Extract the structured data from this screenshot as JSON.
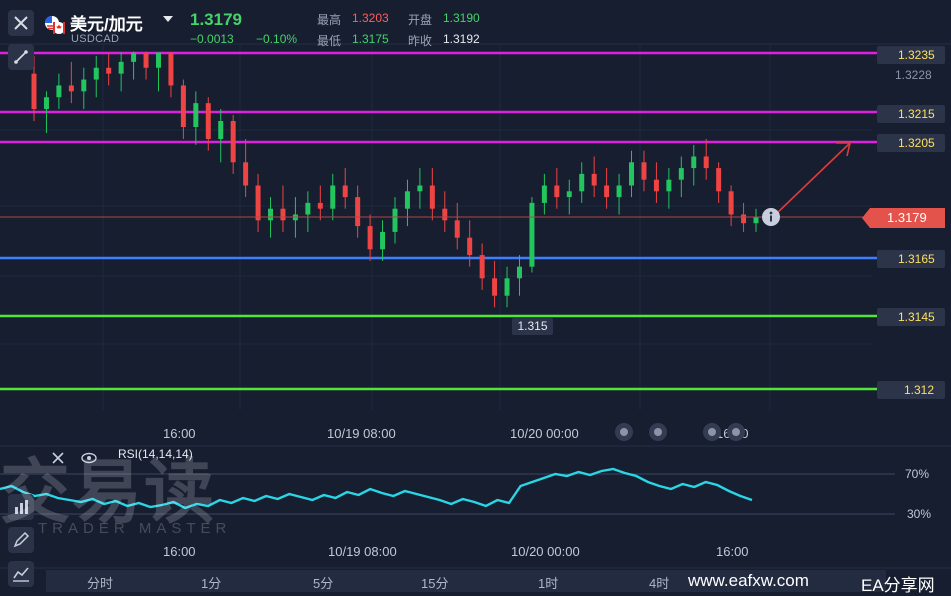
{
  "header": {
    "title": "美元/加元",
    "code": "USDCAD",
    "last": "1.3179",
    "change": "−0.0013",
    "change_pct": "−0.10%",
    "quotes": [
      {
        "label": "最高",
        "value": "1.3203",
        "color": "#ff5d5d"
      },
      {
        "label": "开盘",
        "value": "1.3190",
        "color": "#46d36a"
      },
      {
        "label": "最低",
        "value": "1.3175",
        "color": "#46d36a"
      },
      {
        "label": "昨收",
        "value": "1.3192",
        "color": "#e6e9f0"
      }
    ]
  },
  "levels": [
    {
      "label": "1.3235",
      "value": 1.3235,
      "color": "#e020e0"
    },
    {
      "label": "1.3215",
      "value": 1.3215,
      "color": "#e020e0"
    },
    {
      "label": "1.3205",
      "value": 1.3205,
      "color": "#e020e0"
    },
    {
      "label": "1.3165",
      "value": 1.3165,
      "color": "#3f7fff"
    },
    {
      "label": "1.3145",
      "value": 1.3145,
      "color": "#52e639"
    },
    {
      "label": "1.312",
      "value": 1.312,
      "color": "#52e639"
    }
  ],
  "axis_price_label": "1.3228",
  "current_price_tag": "1.3179",
  "low_tag": "1.315",
  "time_axis": [
    "16:00",
    "10/19 08:00",
    "10/20 00:00",
    "16:00"
  ],
  "rsi": {
    "title": "RSI(14,14,14)",
    "levels": [
      "70%",
      "30%"
    ]
  },
  "rsi_time_axis": [
    "16:00",
    "10/19 08:00",
    "10/20 00:00",
    "16:00"
  ],
  "timeframes": [
    "分时",
    "1分",
    "5分",
    "15分",
    "1时",
    "4时"
  ],
  "watermark": {
    "main": "交易读",
    "sub": "TRADER MASTER"
  },
  "footer": {
    "url": "www.eafxw.com",
    "name": "EA分享网"
  },
  "icons": {
    "close": "close-icon",
    "flag": "us-ca-flag-icon",
    "tools": [
      "draw-line-icon",
      "settings-icon",
      "eye-icon",
      "pen-icon",
      "indicator-icon",
      "info-icon"
    ]
  },
  "chart_data": {
    "type": "candlestick",
    "ylim": [
      1.3108,
      1.3245
    ],
    "up_color": "#22c55e",
    "down_color": "#ef4444",
    "ohlc": [
      [
        1.3228,
        1.3234,
        1.3212,
        1.3216
      ],
      [
        1.3216,
        1.3222,
        1.3208,
        1.322
      ],
      [
        1.322,
        1.3228,
        1.3216,
        1.3224
      ],
      [
        1.3224,
        1.3232,
        1.3218,
        1.3222
      ],
      [
        1.3222,
        1.323,
        1.3216,
        1.3226
      ],
      [
        1.3226,
        1.3234,
        1.322,
        1.323
      ],
      [
        1.323,
        1.3236,
        1.3224,
        1.3228
      ],
      [
        1.3228,
        1.3238,
        1.3222,
        1.3232
      ],
      [
        1.3232,
        1.324,
        1.3226,
        1.3236
      ],
      [
        1.3236,
        1.324,
        1.3226,
        1.323
      ],
      [
        1.323,
        1.3238,
        1.3222,
        1.3236
      ],
      [
        1.3236,
        1.3238,
        1.322,
        1.3224
      ],
      [
        1.3224,
        1.3226,
        1.3206,
        1.321
      ],
      [
        1.321,
        1.3222,
        1.3204,
        1.3218
      ],
      [
        1.3218,
        1.322,
        1.3202,
        1.3206
      ],
      [
        1.3206,
        1.3216,
        1.3198,
        1.3212
      ],
      [
        1.3212,
        1.3214,
        1.3194,
        1.3198
      ],
      [
        1.3198,
        1.3206,
        1.3186,
        1.319
      ],
      [
        1.319,
        1.3194,
        1.3174,
        1.3178
      ],
      [
        1.3178,
        1.3186,
        1.3172,
        1.3182
      ],
      [
        1.3182,
        1.319,
        1.3174,
        1.3178
      ],
      [
        1.3178,
        1.3186,
        1.3172,
        1.318
      ],
      [
        1.318,
        1.3188,
        1.3174,
        1.3184
      ],
      [
        1.3184,
        1.319,
        1.3178,
        1.3182
      ],
      [
        1.3182,
        1.3194,
        1.3178,
        1.319
      ],
      [
        1.319,
        1.3196,
        1.3182,
        1.3186
      ],
      [
        1.3186,
        1.319,
        1.3172,
        1.3176
      ],
      [
        1.3176,
        1.318,
        1.3164,
        1.3168
      ],
      [
        1.3168,
        1.3178,
        1.3164,
        1.3174
      ],
      [
        1.3174,
        1.3186,
        1.317,
        1.3182
      ],
      [
        1.3182,
        1.3192,
        1.3176,
        1.3188
      ],
      [
        1.3188,
        1.3196,
        1.3182,
        1.319
      ],
      [
        1.319,
        1.3196,
        1.3178,
        1.3182
      ],
      [
        1.3182,
        1.3188,
        1.3174,
        1.3178
      ],
      [
        1.3178,
        1.3184,
        1.3168,
        1.3172
      ],
      [
        1.3172,
        1.3178,
        1.3162,
        1.3166
      ],
      [
        1.3166,
        1.317,
        1.3154,
        1.3158
      ],
      [
        1.3158,
        1.3164,
        1.3148,
        1.3152
      ],
      [
        1.3152,
        1.3162,
        1.3148,
        1.3158
      ],
      [
        1.3158,
        1.3166,
        1.3152,
        1.3162
      ],
      [
        1.3162,
        1.3186,
        1.316,
        1.3184
      ],
      [
        1.3184,
        1.3194,
        1.318,
        1.319
      ],
      [
        1.319,
        1.3196,
        1.3182,
        1.3186
      ],
      [
        1.3186,
        1.3192,
        1.318,
        1.3188
      ],
      [
        1.3188,
        1.3198,
        1.3184,
        1.3194
      ],
      [
        1.3194,
        1.32,
        1.3186,
        1.319
      ],
      [
        1.319,
        1.3196,
        1.3182,
        1.3186
      ],
      [
        1.3186,
        1.3194,
        1.318,
        1.319
      ],
      [
        1.319,
        1.3202,
        1.3186,
        1.3198
      ],
      [
        1.3198,
        1.3202,
        1.3188,
        1.3192
      ],
      [
        1.3192,
        1.3198,
        1.3184,
        1.3188
      ],
      [
        1.3188,
        1.3196,
        1.3182,
        1.3192
      ],
      [
        1.3192,
        1.32,
        1.3186,
        1.3196
      ],
      [
        1.3196,
        1.3204,
        1.319,
        1.32
      ],
      [
        1.32,
        1.3206,
        1.3192,
        1.3196
      ],
      [
        1.3196,
        1.3198,
        1.3184,
        1.3188
      ],
      [
        1.3188,
        1.319,
        1.3176,
        1.318
      ],
      [
        1.318,
        1.3184,
        1.3174,
        1.3177
      ],
      [
        1.3177,
        1.3182,
        1.3174,
        1.3179
      ]
    ],
    "rsi": {
      "ylim": [
        0,
        100
      ],
      "levels": [
        70,
        30
      ],
      "values": [
        55,
        58,
        52,
        48,
        50,
        46,
        44,
        42,
        45,
        40,
        43,
        38,
        41,
        37,
        39,
        42,
        36,
        40,
        38,
        44,
        41,
        46,
        43,
        48,
        45,
        50,
        47,
        44,
        49,
        46,
        52,
        49,
        55,
        51,
        48,
        53,
        50,
        47,
        44,
        40,
        45,
        42,
        38,
        44,
        41,
        58,
        62,
        66,
        70,
        68,
        72,
        69,
        73,
        75,
        71,
        68,
        62,
        58,
        55,
        60,
        57,
        62,
        59,
        53,
        48,
        44
      ]
    },
    "annotation": {
      "type": "arrow",
      "from": 1.3179,
      "to": 1.3205,
      "color": "#e03a3a"
    }
  }
}
